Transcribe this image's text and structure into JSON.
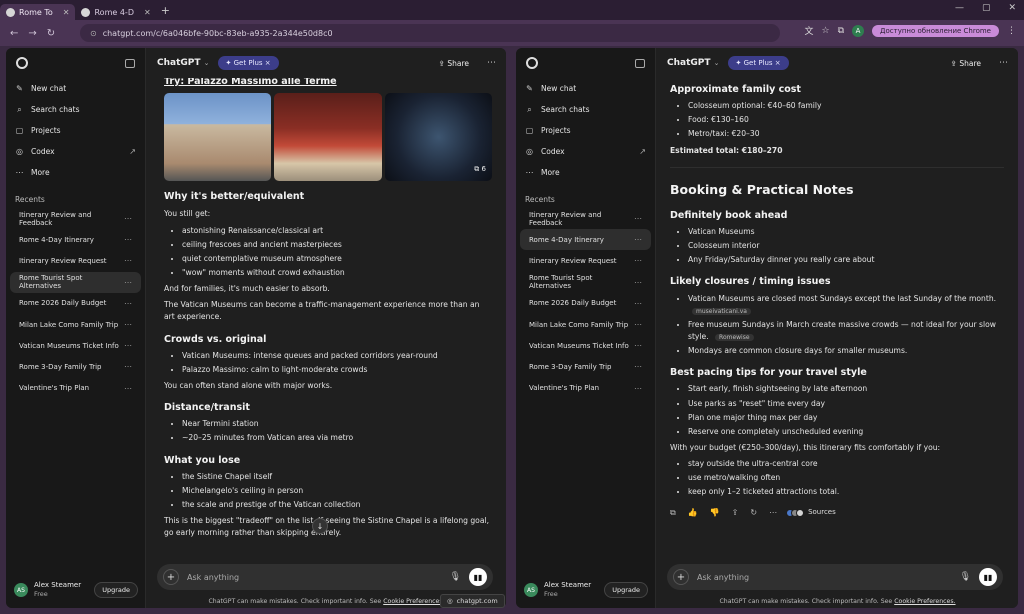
{
  "browser": {
    "tabs": [
      {
        "label": "Rome To"
      },
      {
        "label": "Rome 4-D"
      }
    ],
    "url": "chatgpt.com/c/6a046bfe-90bc-83eb-a935-2a344e50d8c0",
    "update_label": "Доступно обновление Chrome",
    "profile_initial": "A",
    "hover_url": "chatgpt.com"
  },
  "sidebar": {
    "actions": [
      {
        "label": "New chat",
        "icon": "✎"
      },
      {
        "label": "Search chats",
        "icon": "⌕"
      },
      {
        "label": "Projects",
        "icon": "▢"
      },
      {
        "label": "Codex",
        "icon": "◎"
      },
      {
        "label": "More",
        "icon": "⋯"
      }
    ],
    "recents_label": "Recents",
    "chats": [
      "Itinerary Review and Feedback",
      "Rome 4-Day Itinerary",
      "Itinerary Review Request",
      "Rome Tourist Spot Alternatives",
      "Rome 2026 Daily Budget",
      "Milan Lake Como Family Trip",
      "Vatican Museums Ticket Info",
      "Rome 3-Day Family Trip",
      "Valentine's Trip Plan"
    ],
    "user_name": "Alex Steamer",
    "user_plan": "Free",
    "user_initials": "AS",
    "upgrade_label": "Upgrade"
  },
  "header": {
    "model": "ChatGPT",
    "get_plus": "Get Plus",
    "share": "Share"
  },
  "composer": {
    "placeholder": "Ask anything",
    "disclaimer": "ChatGPT can make mistakes. Check important info. See",
    "disclaimer_link": "Cookie Preferences."
  },
  "left": {
    "title_line": "Try: Palazzo Massimo alle Terme",
    "image_count": "6",
    "why_heading": "Why it's better/equivalent",
    "still_get": "You still get:",
    "still_get_items": [
      "astonishing Renaissance/classical art",
      "ceiling frescoes and ancient masterpieces",
      "quiet contemplative museum atmosphere",
      "\"wow\" moments without crowd exhaustion"
    ],
    "families": "And for families, it's much easier to absorb.",
    "traffic": "The Vatican Museums can become a traffic-management experience more than an art experience.",
    "crowds_heading": "Crowds vs. original",
    "crowds_items": [
      "Vatican Museums: intense queues and packed corridors year-round",
      "Palazzo Massimo: calm to light-moderate crowds"
    ],
    "stand_alone": "You can often stand alone with major works.",
    "distance_heading": "Distance/transit",
    "distance_items": [
      "Near Termini station",
      "~20–25 minutes from Vatican area via metro"
    ],
    "lose_heading": "What you lose",
    "lose_items": [
      "the Sistine Chapel itself",
      "Michelangelo's ceiling in person",
      "the scale and prestige of the Vatican collection"
    ],
    "tradeoff": "This is the biggest \"tradeoff\" on the list. If seeing the Sistine Chapel is a lifelong goal, go early morning rather than skipping entirely."
  },
  "right": {
    "cost_heading": "Approximate family cost",
    "cost_items": [
      "Colosseum optional: €40–60 family",
      "Food: €130–160",
      "Metro/taxi: €20–30"
    ],
    "estimated_total": "Estimated total: €180–270",
    "booking_heading": "Booking & Practical Notes",
    "book_ahead_heading": "Definitely book ahead",
    "book_ahead_items": [
      "Vatican Museums",
      "Colosseum interior",
      "Any Friday/Saturday dinner you really care about"
    ],
    "closures_heading": "Likely closures / timing issues",
    "closures_items": [
      {
        "text": "Vatican Museums are closed most Sundays except the last Sunday of the month.",
        "tag": "museivaticani.va"
      },
      {
        "text": "Free museum Sundays in March create massive crowds — not ideal for your slow style.",
        "tag": "Romewise"
      },
      {
        "text": "Mondays are common closure days for smaller museums.",
        "tag": ""
      }
    ],
    "pacing_heading": "Best pacing tips for your travel style",
    "pacing_items": [
      "Start early, finish sightseeing by late afternoon",
      "Use parks as \"reset\" time every day",
      "Plan one major thing max per day",
      "Reserve one completely unscheduled evening"
    ],
    "budget_line": "With your budget (€250–300/day), this itinerary fits comfortably if you:",
    "budget_items": [
      "stay outside the ultra-central core",
      "use metro/walking often",
      "keep only 1–2 ticketed attractions total."
    ],
    "sources_label": "Sources"
  }
}
